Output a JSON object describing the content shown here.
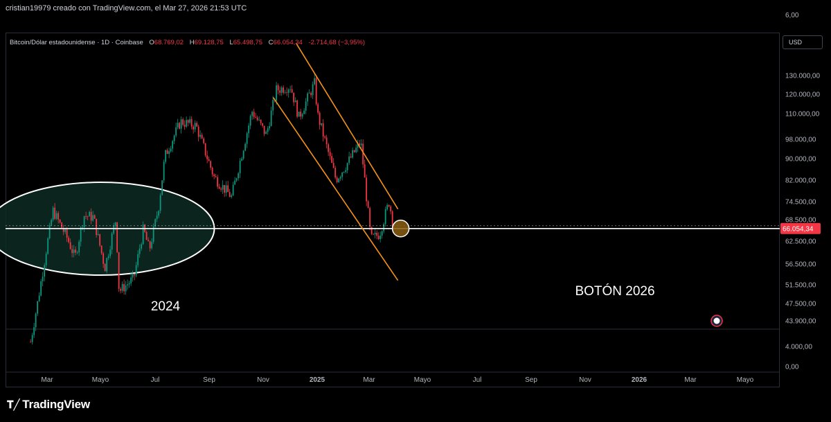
{
  "header": {
    "creator_text": "cristian19979 creado con TradingView.com, el Mar 27, 2026 21:53 UTC"
  },
  "legend": {
    "symbol": "Bitcoin/Dólar estadounidense · 1D · Coinbase",
    "open_key": "O",
    "open": "68.769,02",
    "high_key": "H",
    "high": "69.128,75",
    "low_key": "L",
    "low": "65.498,75",
    "close_key": "C",
    "close": "66.054,34",
    "change": "-2.714,68 (−3,95%)"
  },
  "currency_button": "USD",
  "footer": {
    "brand": "TradingView"
  },
  "colors": {
    "up": "#089981",
    "down": "#f23645",
    "channel": "#f7931a",
    "price_tag": "#f23645",
    "ellipse_fill": "#0d2a22",
    "background": "#000000"
  },
  "chart_data": {
    "type": "candlestick",
    "scale": "logarithmic",
    "title": "Bitcoin/Dólar estadounidense · 1D · Coinbase",
    "y_axis_labels": [
      "6,00",
      "130.000,00",
      "120.000,00",
      "110.000,00",
      "98.000,00",
      "90.000,00",
      "82.000,00",
      "74.500,00",
      "68.500,00",
      "62.500,00",
      "56.500,00",
      "51.500,00",
      "47.500,00",
      "43.900,00",
      "4.000,00",
      "0,00"
    ],
    "x_axis_labels": [
      "Mar",
      "Mayo",
      "Jul",
      "Sep",
      "Nov",
      "2025",
      "Mar",
      "Mayo",
      "Jul",
      "Sep",
      "Nov",
      "2026",
      "Mar",
      "Mayo"
    ],
    "last_price": 66054.34,
    "last_price_label": "66.054,34",
    "horizontal_line": 66054.34,
    "price_path": [
      {
        "date": "2024-01-25",
        "price": 40000
      },
      {
        "date": "2024-02-10",
        "price": 48000
      },
      {
        "date": "2024-02-28",
        "price": 60000
      },
      {
        "date": "2024-03-14",
        "price": 71500
      },
      {
        "date": "2024-04-15",
        "price": 63000
      },
      {
        "date": "2024-05-01",
        "price": 58000
      },
      {
        "date": "2024-05-20",
        "price": 70000
      },
      {
        "date": "2024-06-10",
        "price": 69500
      },
      {
        "date": "2024-07-05",
        "price": 55500
      },
      {
        "date": "2024-07-29",
        "price": 69000
      },
      {
        "date": "2024-08-05",
        "price": 50000
      },
      {
        "date": "2024-09-06",
        "price": 53000
      },
      {
        "date": "2024-09-27",
        "price": 66000
      },
      {
        "date": "2024-10-10",
        "price": 60000
      },
      {
        "date": "2024-10-30",
        "price": 72500
      },
      {
        "date": "2024-11-13",
        "price": 91000
      },
      {
        "date": "2024-12-17",
        "price": 106000
      },
      {
        "date": "2025-01-20",
        "price": 104000
      },
      {
        "date": "2025-02-28",
        "price": 83000
      },
      {
        "date": "2025-04-07",
        "price": 76000
      },
      {
        "date": "2025-05-22",
        "price": 111000
      },
      {
        "date": "2025-06-22",
        "price": 100000
      },
      {
        "date": "2025-07-14",
        "price": 122000
      },
      {
        "date": "2025-08-14",
        "price": 124000
      },
      {
        "date": "2025-09-01",
        "price": 108000
      },
      {
        "date": "2025-10-06",
        "price": 126000
      },
      {
        "date": "2025-10-11",
        "price": 110000
      },
      {
        "date": "2025-11-21",
        "price": 82000
      },
      {
        "date": "2025-12-15",
        "price": 88000
      },
      {
        "date": "2026-01-14",
        "price": 97000
      },
      {
        "date": "2026-02-05",
        "price": 63000
      },
      {
        "date": "2026-02-24",
        "price": 64500
      },
      {
        "date": "2026-03-17",
        "price": 74500
      },
      {
        "date": "2026-03-27",
        "price": 66054.34
      }
    ],
    "channel_lines": [
      {
        "start": {
          "date": "2025-07-07",
          "price": 118000
        },
        "end": {
          "date": "2026-04-05",
          "price": 52500
        }
      },
      {
        "start": {
          "date": "2025-08-26",
          "price": 150000
        },
        "end": {
          "date": "2026-04-05",
          "price": 72000
        }
      }
    ],
    "ellipse": {
      "center_date": "2024-06-26",
      "center_price": 66000
    },
    "circle": {
      "date": "2026-03-27",
      "price": 66054.34
    },
    "annotations": [
      "2024",
      "BOTÓN 2026"
    ]
  }
}
